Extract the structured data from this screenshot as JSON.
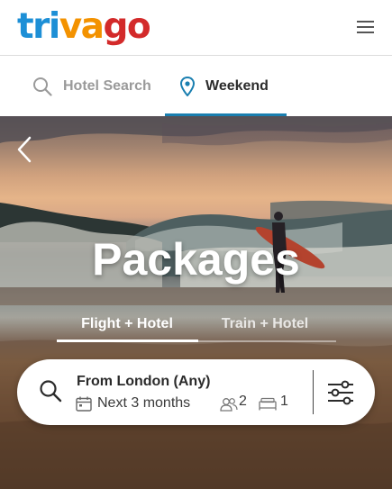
{
  "header": {
    "logo": {
      "part1": "tri",
      "part2": "va",
      "part3": "go"
    },
    "menu_icon": "hamburger-menu-icon"
  },
  "tabs": [
    {
      "label": "Hotel Search",
      "icon": "search-icon",
      "active": false
    },
    {
      "label": "Weekend",
      "icon": "location-pin-icon",
      "active": true
    }
  ],
  "hero": {
    "back_icon": "chevron-left-icon",
    "title": "Packages",
    "package_tabs": [
      {
        "label": "Flight + Hotel",
        "active": true
      },
      {
        "label": "Train + Hotel",
        "active": false
      }
    ]
  },
  "search": {
    "origin": "From London (Any)",
    "dates": "Next 3 months",
    "guests": "2",
    "rooms": "1",
    "icons": [
      "search-icon",
      "calendar-icon",
      "guests-icon",
      "bed-icon",
      "filter-sliders-icon"
    ]
  },
  "colors": {
    "logo_blue": "#1d8fd6",
    "logo_orange": "#f39200",
    "logo_red": "#d32a2a",
    "accent": "#1a7fb0"
  }
}
